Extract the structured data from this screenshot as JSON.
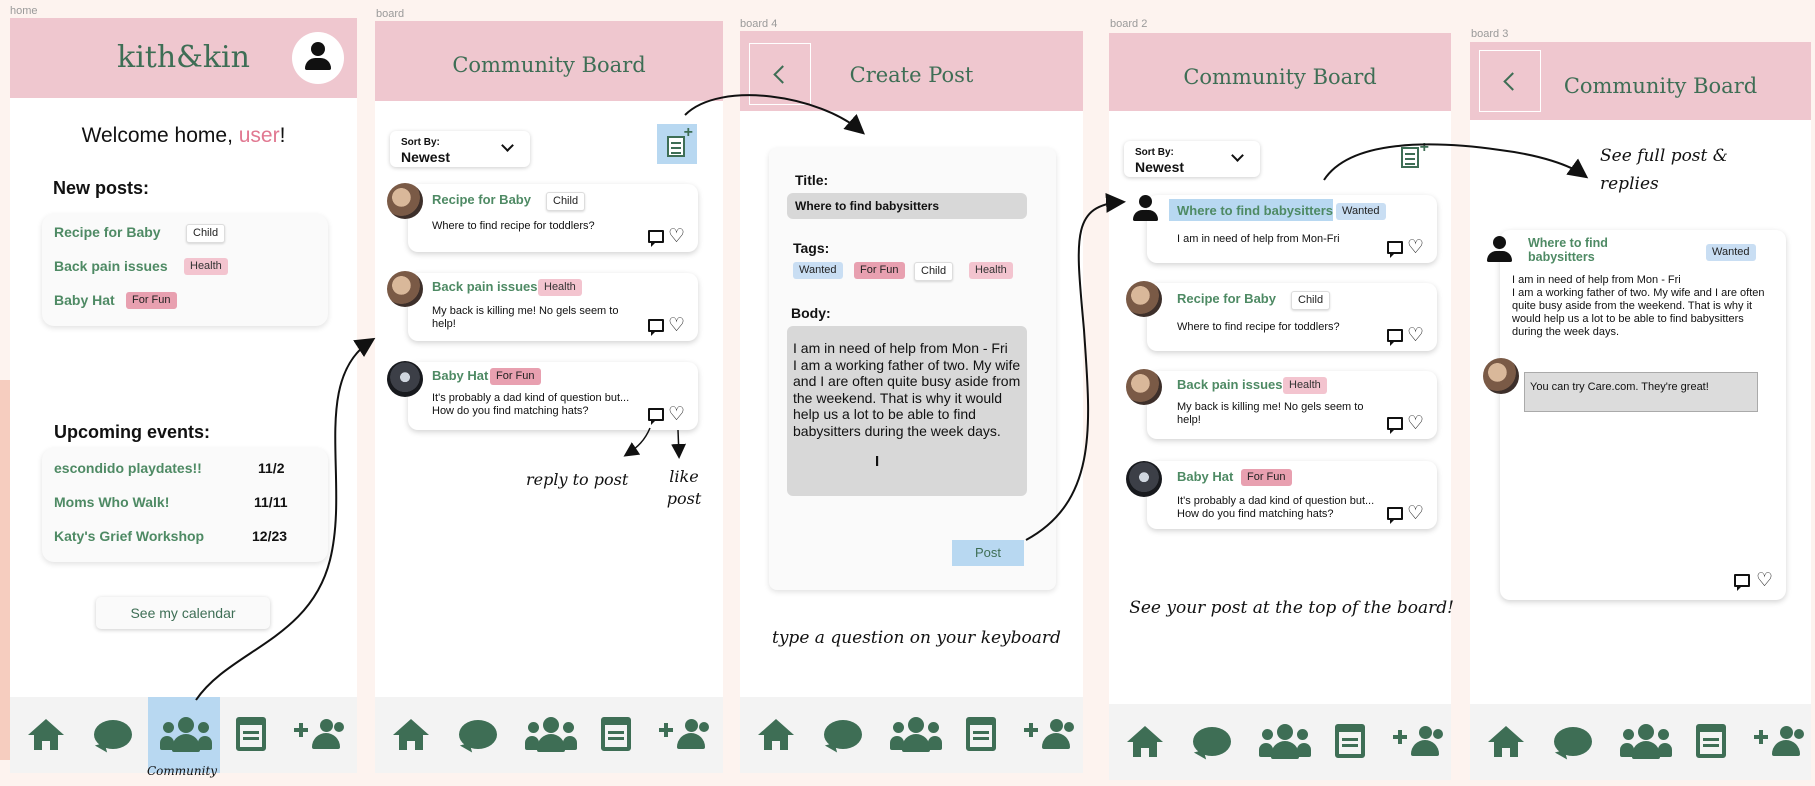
{
  "frames": {
    "home": "home",
    "board": "board",
    "board4": "board 4",
    "board2": "board 2",
    "board3": "board 3"
  },
  "colors": {
    "header_pink": "#efc7cf",
    "brand_green": "#3e6e55",
    "link_green": "#4e8a64",
    "highlight_blue": "#b8d8f1",
    "user_pink": "#e17891"
  },
  "home": {
    "brand": "kith&kin",
    "welcome_prefix": "Welcome home, ",
    "welcome_user": "user",
    "welcome_suffix": "!",
    "new_posts_title": "New posts:",
    "new_posts": [
      {
        "title": "Recipe for Baby",
        "tag": "Child"
      },
      {
        "title": "Back pain issues",
        "tag": "Health"
      },
      {
        "title": "Baby Hat",
        "tag": "For Fun"
      }
    ],
    "events_title": "Upcoming events:",
    "events": [
      {
        "name": "escondido playdates!!",
        "date": "11/2"
      },
      {
        "name": "Moms Who Walk!",
        "date": "11/11"
      },
      {
        "name": "Katy's Grief Workshop",
        "date": "12/23"
      }
    ],
    "calendar_button": "See my calendar",
    "annotation_community": "Community"
  },
  "board": {
    "title": "Community Board",
    "sort_label": "Sort By:",
    "sort_value": "Newest",
    "posts": [
      {
        "title": "Recipe for Baby",
        "tag": "Child",
        "body": "Where to find recipe for toddlers?"
      },
      {
        "title": "Back pain issues",
        "tag": "Health",
        "body": "My back is killing me! No gels seem to help!"
      },
      {
        "title": "Baby Hat",
        "tag": "For Fun",
        "body": "It's probably a dad kind of question but... How do you find matching hats?"
      }
    ],
    "annotation_reply": "reply to post",
    "annotation_like": "like post"
  },
  "create": {
    "title": "Create Post",
    "title_label": "Title:",
    "title_value": "Where to find babysitters",
    "tags_label": "Tags:",
    "tags": [
      "Wanted",
      "For Fun",
      "Child",
      "Health"
    ],
    "body_label": "Body:",
    "body_value": "I am in need of help from Mon - Fri\nI am a working father of two. My wife and I are often quite busy aside from the weekend. That is why it would help us a lot to be able to find babysitters during the week days.",
    "post_button": "Post",
    "annotation": "type a question on your keyboard"
  },
  "board2": {
    "title": "Community Board",
    "sort_label": "Sort By:",
    "sort_value": "Newest",
    "posts": [
      {
        "title": "Where to find babysitters",
        "tag": "Wanted",
        "body": "I am in need of help from Mon-Fri"
      },
      {
        "title": "Recipe for Baby",
        "tag": "Child",
        "body": "Where to find recipe for toddlers?"
      },
      {
        "title": "Back pain issues",
        "tag": "Health",
        "body": "My back is killing me! No gels seem to help!"
      },
      {
        "title": "Baby Hat",
        "tag": "For Fun",
        "body": "It's probably a dad kind of question but... How do you find matching hats?"
      }
    ],
    "annotation": "See your post at the top of the board!"
  },
  "board3": {
    "title": "Community Board",
    "post_title": "Where to find babysitters",
    "post_tag": "Wanted",
    "post_body": "I am in need of help from Mon - Fri\nI am a working father of two. My wife and I are often quite busy aside from the weekend. That is why it would help us a lot to be able to find babysitters during the week days.",
    "reply": "You can try Care.com. They're great!",
    "annotation": "See full post & replies"
  }
}
